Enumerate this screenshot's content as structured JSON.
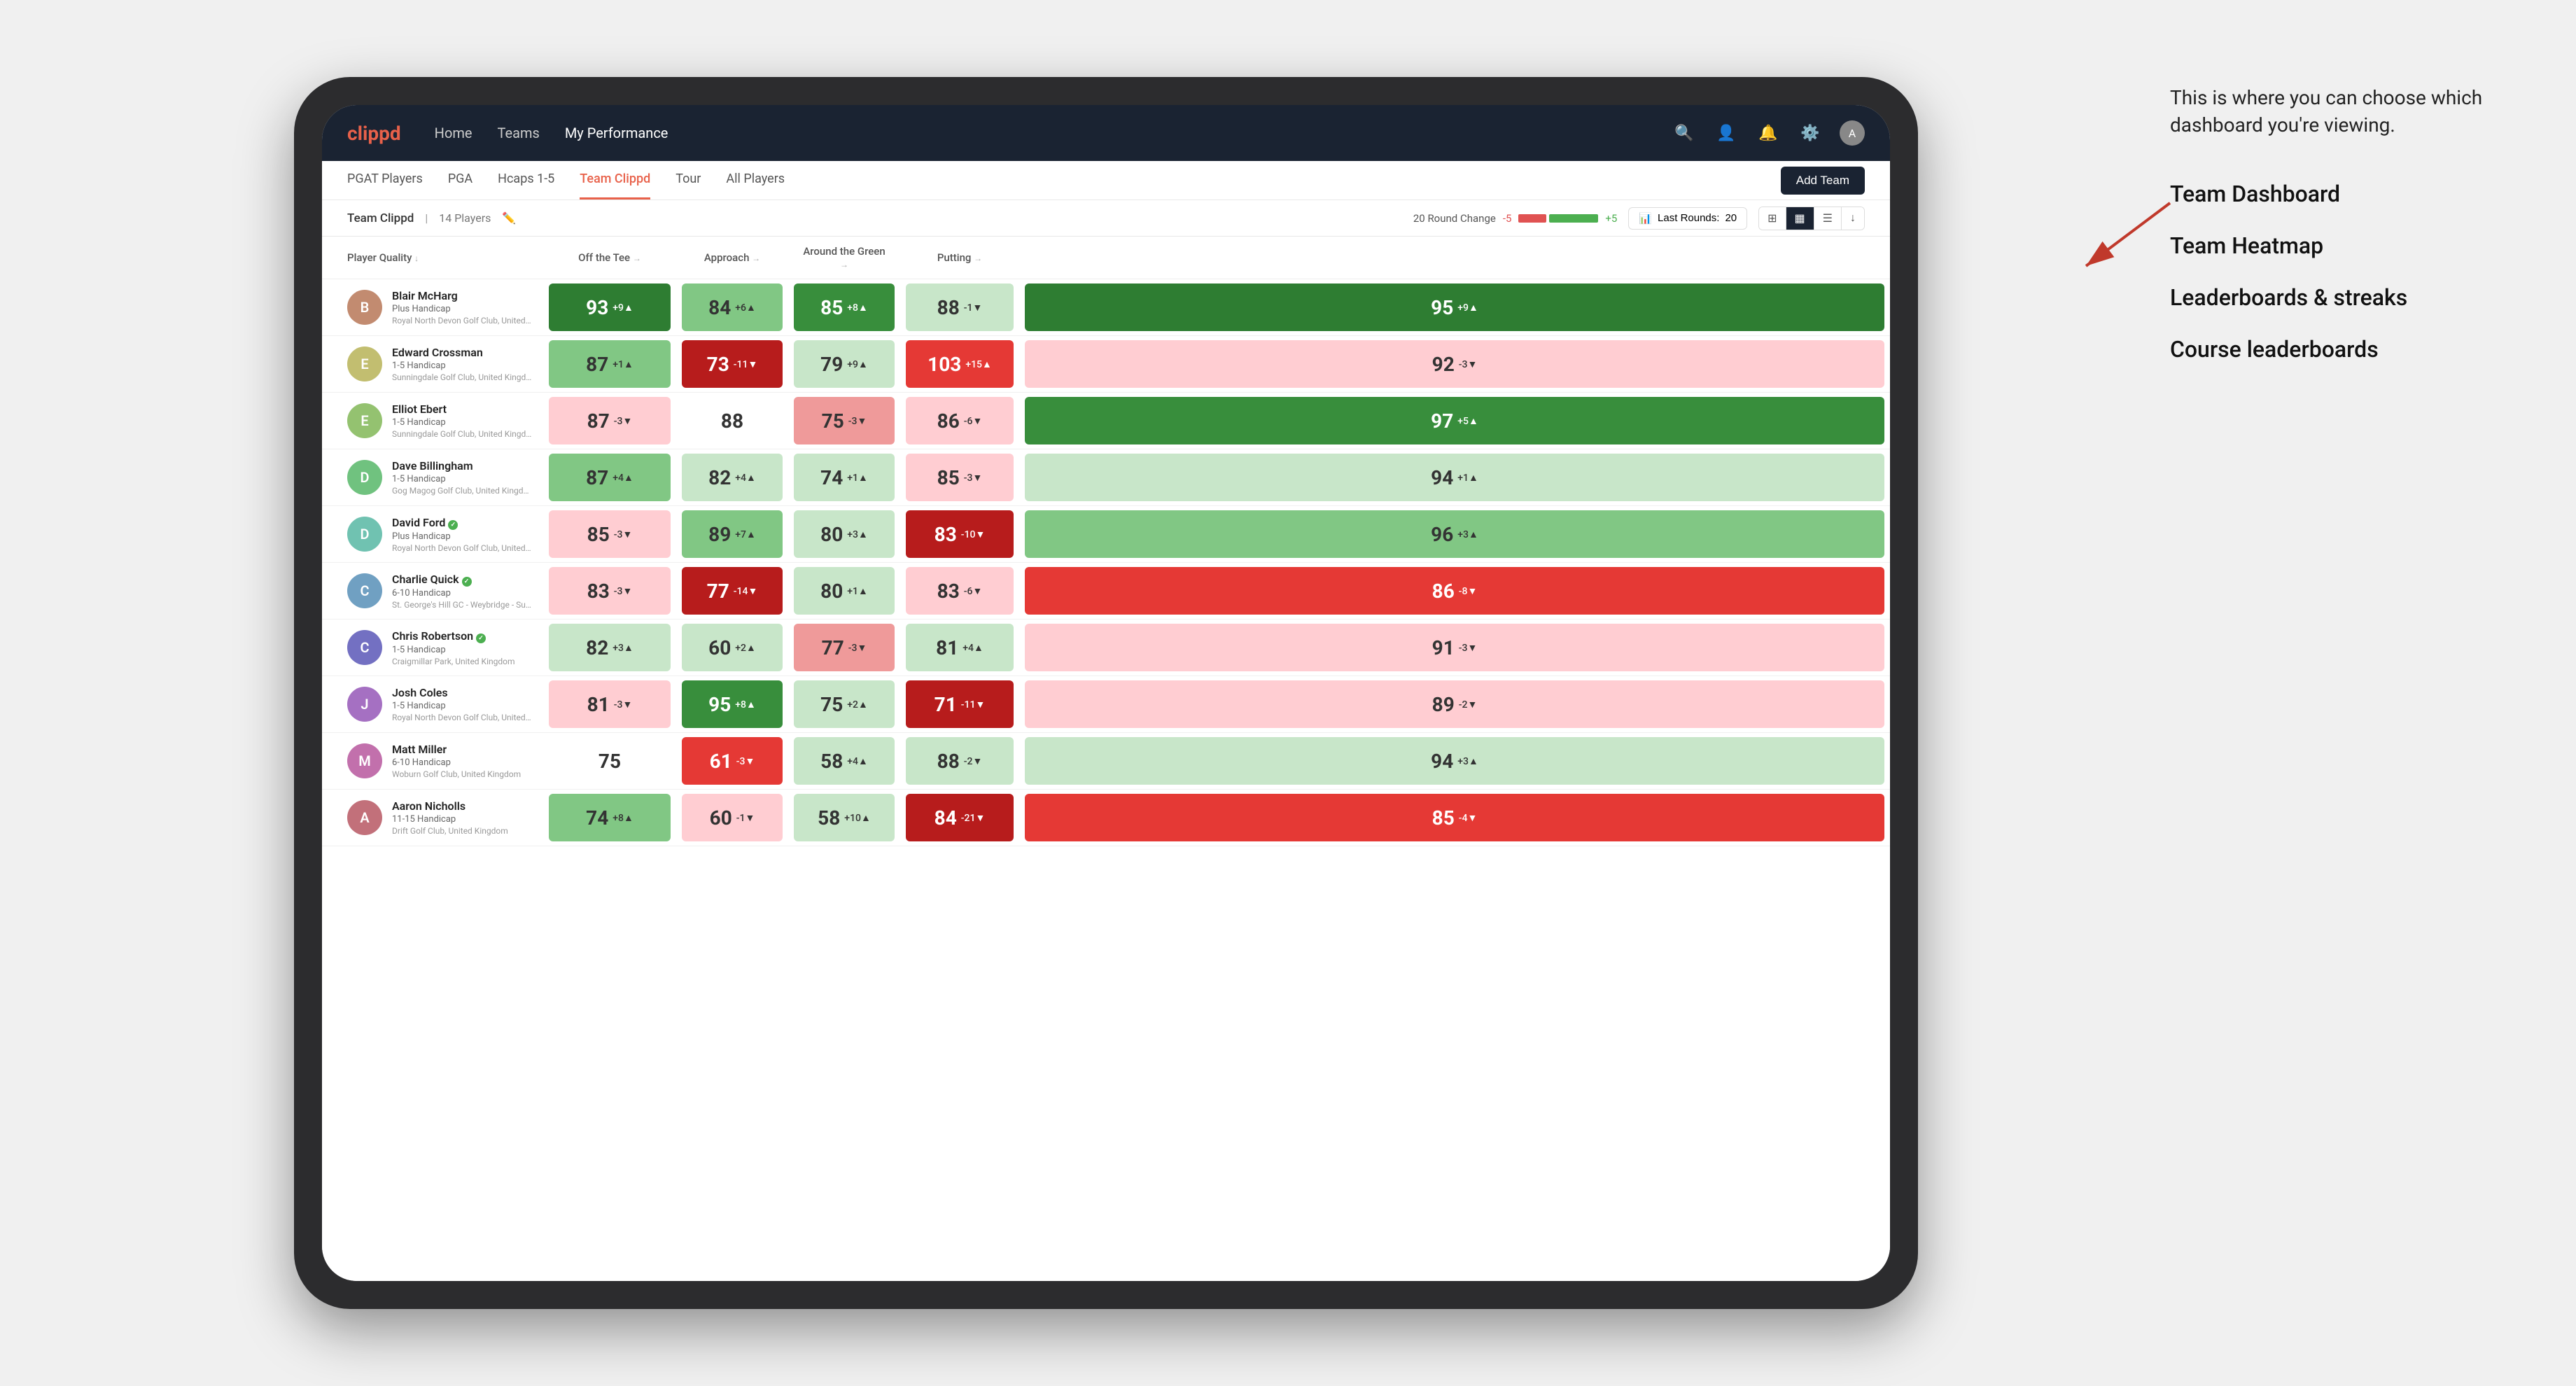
{
  "annotation": {
    "intro": "This is where you can choose which dashboard you're viewing.",
    "options": [
      "Team Dashboard",
      "Team Heatmap",
      "Leaderboards & streaks",
      "Course leaderboards"
    ]
  },
  "nav": {
    "logo": "clippd",
    "items": [
      "Home",
      "Teams",
      "My Performance"
    ],
    "active": "My Performance"
  },
  "sub_nav": {
    "tabs": [
      "PGAT Players",
      "PGA",
      "Hcaps 1-5",
      "Team Clippd",
      "Tour",
      "All Players"
    ],
    "active": "Team Clippd",
    "add_team": "Add Team"
  },
  "team_header": {
    "name": "Team Clippd",
    "separator": "|",
    "count": "14 Players",
    "round_change_label": "20 Round Change",
    "neg5": "-5",
    "pos5": "+5",
    "last_rounds_label": "Last Rounds:",
    "last_rounds_value": "20"
  },
  "table": {
    "columns": [
      "Player Quality ↓",
      "Off the Tee →",
      "Approach →",
      "Around the Green →",
      "Putting →"
    ],
    "rows": [
      {
        "name": "Blair McHarg",
        "handicap": "Plus Handicap",
        "club": "Royal North Devon Golf Club, United Kingdom",
        "verified": false,
        "scores": [
          {
            "value": 93,
            "change": "+9",
            "dir": "up",
            "color": "green-dark"
          },
          {
            "value": 84,
            "change": "+6",
            "dir": "up",
            "color": "green-light"
          },
          {
            "value": 85,
            "change": "+8",
            "dir": "up",
            "color": "green-med"
          },
          {
            "value": 88,
            "change": "-1",
            "dir": "down",
            "color": "pale-green"
          },
          {
            "value": 95,
            "change": "+9",
            "dir": "up",
            "color": "green-dark"
          }
        ]
      },
      {
        "name": "Edward Crossman",
        "handicap": "1-5 Handicap",
        "club": "Sunningdale Golf Club, United Kingdom",
        "verified": false,
        "scores": [
          {
            "value": 87,
            "change": "+1",
            "dir": "up",
            "color": "green-light"
          },
          {
            "value": 73,
            "change": "-11",
            "dir": "down",
            "color": "red-dark"
          },
          {
            "value": 79,
            "change": "+9",
            "dir": "up",
            "color": "pale-green"
          },
          {
            "value": 103,
            "change": "+15",
            "dir": "up",
            "color": "red-med"
          },
          {
            "value": 92,
            "change": "-3",
            "dir": "down",
            "color": "pale-red"
          }
        ]
      },
      {
        "name": "Elliot Ebert",
        "handicap": "1-5 Handicap",
        "club": "Sunningdale Golf Club, United Kingdom",
        "verified": false,
        "scores": [
          {
            "value": 87,
            "change": "-3",
            "dir": "down",
            "color": "pale-red"
          },
          {
            "value": 88,
            "change": "",
            "dir": "",
            "color": "white-cell"
          },
          {
            "value": 75,
            "change": "-3",
            "dir": "down",
            "color": "red-light"
          },
          {
            "value": 86,
            "change": "-6",
            "dir": "down",
            "color": "pale-red"
          },
          {
            "value": 97,
            "change": "+5",
            "dir": "up",
            "color": "green-med"
          }
        ]
      },
      {
        "name": "Dave Billingham",
        "handicap": "1-5 Handicap",
        "club": "Gog Magog Golf Club, United Kingdom",
        "verified": false,
        "scores": [
          {
            "value": 87,
            "change": "+4",
            "dir": "up",
            "color": "green-light"
          },
          {
            "value": 82,
            "change": "+4",
            "dir": "up",
            "color": "pale-green"
          },
          {
            "value": 74,
            "change": "+1",
            "dir": "up",
            "color": "pale-green"
          },
          {
            "value": 85,
            "change": "-3",
            "dir": "down",
            "color": "pale-red"
          },
          {
            "value": 94,
            "change": "+1",
            "dir": "up",
            "color": "pale-green"
          }
        ]
      },
      {
        "name": "David Ford",
        "handicap": "Plus Handicap",
        "club": "Royal North Devon Golf Club, United Kingdom",
        "verified": true,
        "scores": [
          {
            "value": 85,
            "change": "-3",
            "dir": "down",
            "color": "pale-red"
          },
          {
            "value": 89,
            "change": "+7",
            "dir": "up",
            "color": "green-light"
          },
          {
            "value": 80,
            "change": "+3",
            "dir": "up",
            "color": "pale-green"
          },
          {
            "value": 83,
            "change": "-10",
            "dir": "down",
            "color": "red-dark"
          },
          {
            "value": 96,
            "change": "+3",
            "dir": "up",
            "color": "green-light"
          }
        ]
      },
      {
        "name": "Charlie Quick",
        "handicap": "6-10 Handicap",
        "club": "St. George's Hill GC - Weybridge - Surrey, Uni...",
        "verified": true,
        "scores": [
          {
            "value": 83,
            "change": "-3",
            "dir": "down",
            "color": "pale-red"
          },
          {
            "value": 77,
            "change": "-14",
            "dir": "down",
            "color": "red-dark"
          },
          {
            "value": 80,
            "change": "+1",
            "dir": "up",
            "color": "pale-green"
          },
          {
            "value": 83,
            "change": "-6",
            "dir": "down",
            "color": "pale-red"
          },
          {
            "value": 86,
            "change": "-8",
            "dir": "down",
            "color": "red-med"
          }
        ]
      },
      {
        "name": "Chris Robertson",
        "handicap": "1-5 Handicap",
        "club": "Craigmillar Park, United Kingdom",
        "verified": true,
        "scores": [
          {
            "value": 82,
            "change": "+3",
            "dir": "up",
            "color": "pale-green"
          },
          {
            "value": 60,
            "change": "+2",
            "dir": "up",
            "color": "pale-green"
          },
          {
            "value": 77,
            "change": "-3",
            "dir": "down",
            "color": "red-light"
          },
          {
            "value": 81,
            "change": "+4",
            "dir": "up",
            "color": "pale-green"
          },
          {
            "value": 91,
            "change": "-3",
            "dir": "down",
            "color": "pale-red"
          }
        ]
      },
      {
        "name": "Josh Coles",
        "handicap": "1-5 Handicap",
        "club": "Royal North Devon Golf Club, United Kingdom",
        "verified": false,
        "scores": [
          {
            "value": 81,
            "change": "-3",
            "dir": "down",
            "color": "pale-red"
          },
          {
            "value": 95,
            "change": "+8",
            "dir": "up",
            "color": "green-med"
          },
          {
            "value": 75,
            "change": "+2",
            "dir": "up",
            "color": "pale-green"
          },
          {
            "value": 71,
            "change": "-11",
            "dir": "down",
            "color": "red-dark"
          },
          {
            "value": 89,
            "change": "-2",
            "dir": "down",
            "color": "pale-red"
          }
        ]
      },
      {
        "name": "Matt Miller",
        "handicap": "6-10 Handicap",
        "club": "Woburn Golf Club, United Kingdom",
        "verified": false,
        "scores": [
          {
            "value": 75,
            "change": "",
            "dir": "",
            "color": "white-cell"
          },
          {
            "value": 61,
            "change": "-3",
            "dir": "down",
            "color": "red-med"
          },
          {
            "value": 58,
            "change": "+4",
            "dir": "up",
            "color": "pale-green"
          },
          {
            "value": 88,
            "change": "-2",
            "dir": "down",
            "color": "pale-green"
          },
          {
            "value": 94,
            "change": "+3",
            "dir": "up",
            "color": "pale-green"
          }
        ]
      },
      {
        "name": "Aaron Nicholls",
        "handicap": "11-15 Handicap",
        "club": "Drift Golf Club, United Kingdom",
        "verified": false,
        "scores": [
          {
            "value": 74,
            "change": "+8",
            "dir": "up",
            "color": "green-light"
          },
          {
            "value": 60,
            "change": "-1",
            "dir": "down",
            "color": "pale-red"
          },
          {
            "value": 58,
            "change": "+10",
            "dir": "up",
            "color": "pale-green"
          },
          {
            "value": 84,
            "change": "-21",
            "dir": "down",
            "color": "red-dark"
          },
          {
            "value": 85,
            "change": "-4",
            "dir": "down",
            "color": "red-med"
          }
        ]
      }
    ]
  }
}
